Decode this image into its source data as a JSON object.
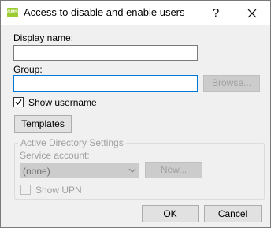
{
  "window": {
    "app_icon_text": "GMS",
    "title": "Access to disable and enable users",
    "help_label": "?"
  },
  "form": {
    "display_name_label": "Display name:",
    "display_name_value": "",
    "group_label": "Group:",
    "group_value": "",
    "browse_label": "Browse...",
    "show_username_label": "Show username",
    "show_username_checked": true,
    "templates_label": "Templates"
  },
  "active_directory": {
    "legend": "Active Directory Settings",
    "service_account_label": "Service account:",
    "service_account_selected": "(none)",
    "new_label": "New...",
    "show_upn_label": "Show UPN",
    "show_upn_checked": false
  },
  "footer": {
    "ok_label": "OK",
    "cancel_label": "Cancel"
  },
  "icons": {
    "close": "close-icon",
    "checkmark": "checkmark-icon",
    "dropdown": "chevron-down-icon"
  }
}
